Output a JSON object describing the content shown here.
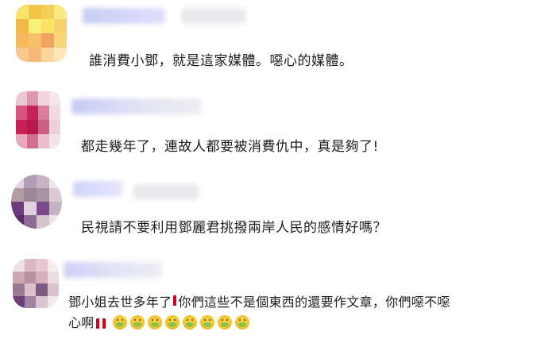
{
  "comments": [
    {
      "text": "誰消費小鄧，就是這家媒體。噁心的媒體。"
    },
    {
      "text": "都走幾年了，連故人都要被消費仇中，真是夠了!"
    },
    {
      "text": "民視請不要利用鄧麗君挑撥兩岸人民的感情好嗎？"
    },
    {
      "text_part1": "鄧小姐去世多年了",
      "text_part2": "你們這些不是個東西的還要作文章，你們噁不噁",
      "text_part3": "心啊"
    }
  ],
  "icons": {
    "exclamation": "red-exclamation-icon",
    "nauseated": "nauseated-face-icon"
  }
}
